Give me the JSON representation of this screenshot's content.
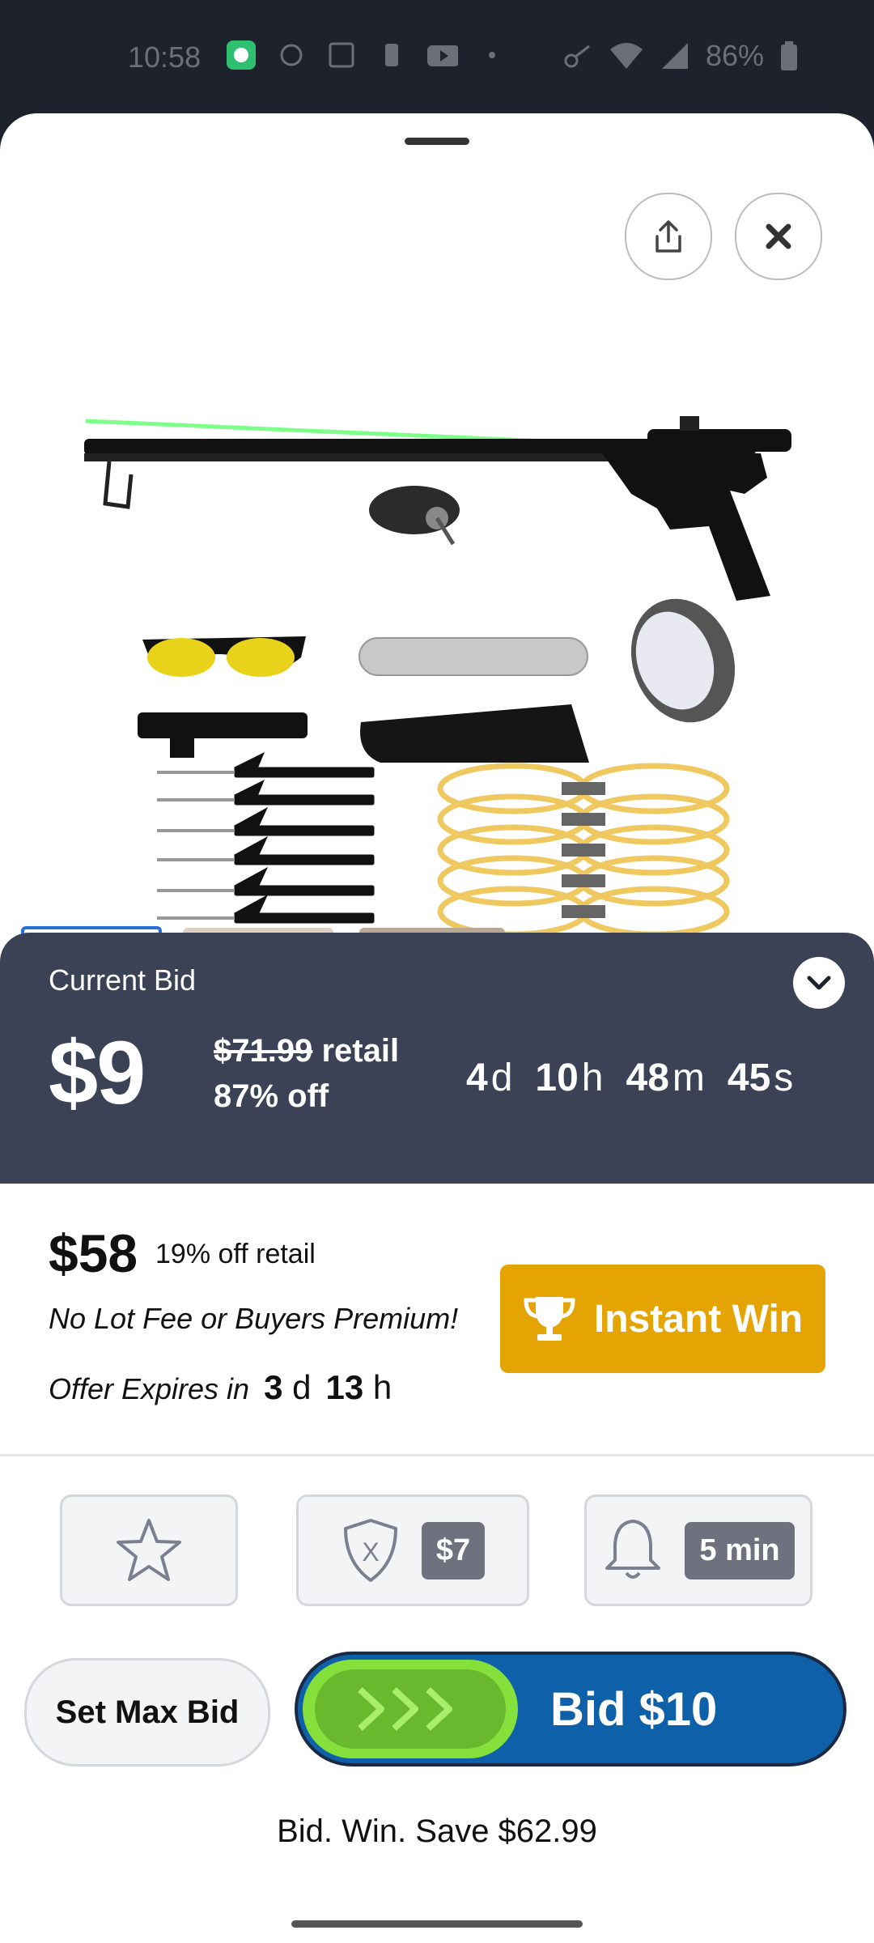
{
  "status_bar": {
    "time": "10:58",
    "battery": "86%"
  },
  "product": {
    "image_alt": "Slingshot fishing kit"
  },
  "bid_panel": {
    "current_bid_label": "Current Bid",
    "current_bid": "$9",
    "retail_price": "$71.99",
    "retail_label": "retail",
    "discount": "87% off",
    "timer": {
      "days": "4",
      "days_unit": "d",
      "hours": "10",
      "hours_unit": "h",
      "minutes": "48",
      "minutes_unit": "m",
      "seconds": "45",
      "seconds_unit": "s"
    }
  },
  "instant_win": {
    "price": "$58",
    "discount": "19% off retail",
    "no_fee": "No Lot Fee or Buyers Premium!",
    "expires_label": "Offer Expires in",
    "expires_days": "3",
    "expires_days_unit": "d",
    "expires_hours": "13",
    "expires_hours_unit": "h",
    "button_label": "Instant Win"
  },
  "actions": {
    "shield_value": "$7",
    "alert_value": "5 min"
  },
  "bidding": {
    "set_max_label": "Set Max Bid",
    "bid_label": "Bid $10",
    "tagline": "Bid. Win. Save $62.99"
  },
  "colors": {
    "panel": "#3b4256",
    "instant_win": "#e3a404",
    "bid_button": "#0e61a8",
    "slider": "#86e03b"
  }
}
